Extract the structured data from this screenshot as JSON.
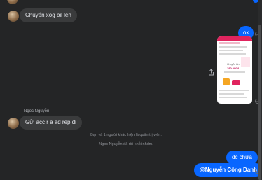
{
  "conversation": {
    "messages": [
      {
        "id": "m1",
        "text": "Chuyển xog bil lên"
      },
      {
        "id": "m2",
        "text": "ok"
      },
      {
        "id": "m3",
        "sender": "Ngoc Nguyễn",
        "text": "Gửi acc r á ad rep đi"
      },
      {
        "id": "m4",
        "text": "dc chưa"
      },
      {
        "id": "m5",
        "text": "@Nguyễn Công Danh"
      }
    ],
    "system_notices": [
      "Bạn và 1 người khác hiện là quản trị viên.",
      "Ngoc Nguyễn đã rời khỏi nhóm."
    ],
    "attachment": {
      "card_label": "Chuyển tiền",
      "card_amount": "180.000đ"
    }
  },
  "colors": {
    "background": "#242526",
    "incoming_bubble": "#3a3b3c",
    "outgoing_bubble": "#0866ff",
    "system_text": "#8f9297"
  },
  "icons": {
    "share": "share-icon",
    "seen": "seen-check-icon",
    "avatar": "avatar"
  }
}
